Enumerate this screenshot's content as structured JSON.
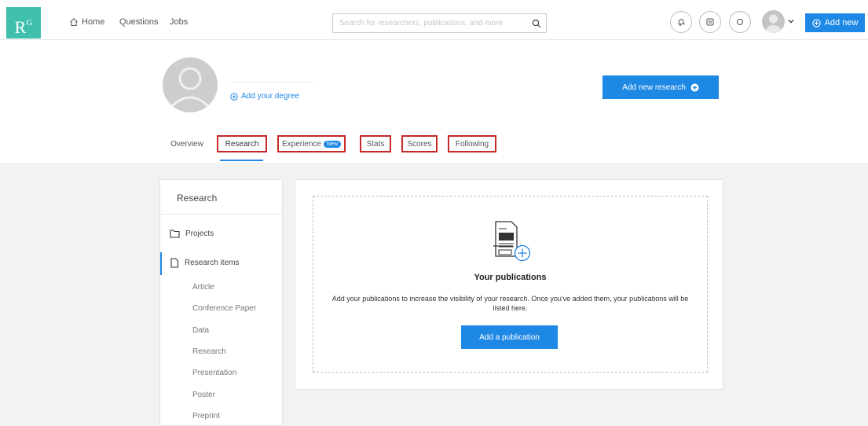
{
  "header": {
    "logo_main": "R",
    "logo_sup": "G",
    "nav": [
      {
        "label": "Home",
        "icon": "home-icon"
      },
      {
        "label": "Questions"
      },
      {
        "label": "Jobs"
      }
    ],
    "search": {
      "placeholder": "Search for researchers, publications, and more"
    },
    "icon_buttons": [
      "notifications-icon",
      "messages-icon",
      "chat-icon"
    ],
    "add_new_label": "Add new"
  },
  "profile": {
    "add_degree_label": "Add your degree",
    "add_research_label": "Add new research"
  },
  "tabs": [
    {
      "label": "Overview",
      "highlighted": false
    },
    {
      "label": "Research",
      "highlighted": true,
      "active": true
    },
    {
      "label": "Experience",
      "highlighted": true,
      "badge": "New"
    },
    {
      "label": "Stats",
      "highlighted": true
    },
    {
      "label": "Scores",
      "highlighted": true
    },
    {
      "label": "Following",
      "highlighted": true
    }
  ],
  "sidebar": {
    "title": "Research",
    "items": [
      {
        "label": "Projects",
        "icon": "folder-icon"
      },
      {
        "label": "Research items",
        "icon": "document-icon",
        "active": true
      }
    ],
    "sub_items": [
      "Article",
      "Conference Paper",
      "Data",
      "Research",
      "Presentation",
      "Poster",
      "Preprint"
    ]
  },
  "main": {
    "title": "Your publications",
    "description": "Add your publications to increase the visibility of your research. Once you've added them, your publications will be listed here.",
    "button_label": "Add a publication"
  },
  "colors": {
    "accent": "#1e88e5",
    "logo": "#40bfad",
    "highlight_box": "#c62828",
    "background": "#f2f2f2"
  }
}
